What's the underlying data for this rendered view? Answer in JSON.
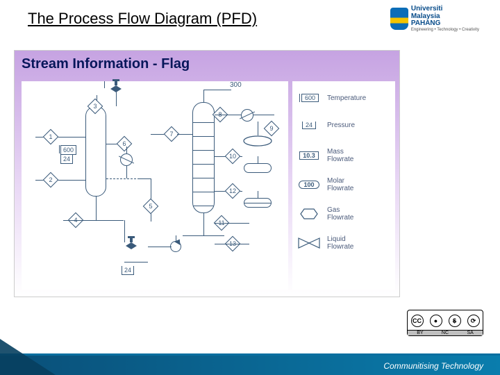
{
  "header": {
    "title": "The Process Flow Diagram (PFD)"
  },
  "logo": {
    "line1": "Universiti",
    "line2": "Malaysia",
    "line3": "PAHANG",
    "sub": "Engineering • Technology • Creativity"
  },
  "subhead": "Stream Information - Flag",
  "streams": {
    "s1": "1",
    "s2": "2",
    "s3": "3",
    "s4": "4",
    "s5": "5",
    "s6": "6",
    "s7": "7",
    "s8": "8",
    "s9": "9",
    "s10": "10",
    "s11": "11",
    "s12": "12",
    "s13": "13"
  },
  "flags": {
    "temp_col": "600",
    "press_col": "24",
    "press_bottom": "24",
    "label300": "300"
  },
  "legend": {
    "temp": {
      "value": "600",
      "label": "Temperature"
    },
    "press": {
      "value": "24",
      "label": "Pressure"
    },
    "mass": {
      "value": "10.3",
      "label": "Mass\nFlowrate"
    },
    "molar": {
      "value": "100",
      "label": "Molar\nFlowrate"
    },
    "gas": {
      "label": "Gas\nFlowrate"
    },
    "liq": {
      "label": "Liquid\nFlowrate"
    }
  },
  "footer": {
    "tagline": "Communitising Technology"
  },
  "cc": {
    "lab_by": "BY",
    "lab_nc": "NC",
    "lab_sa": "SA",
    "cc": "CC",
    "person": "●",
    "dollar": "$",
    "cycle": "⟳"
  }
}
